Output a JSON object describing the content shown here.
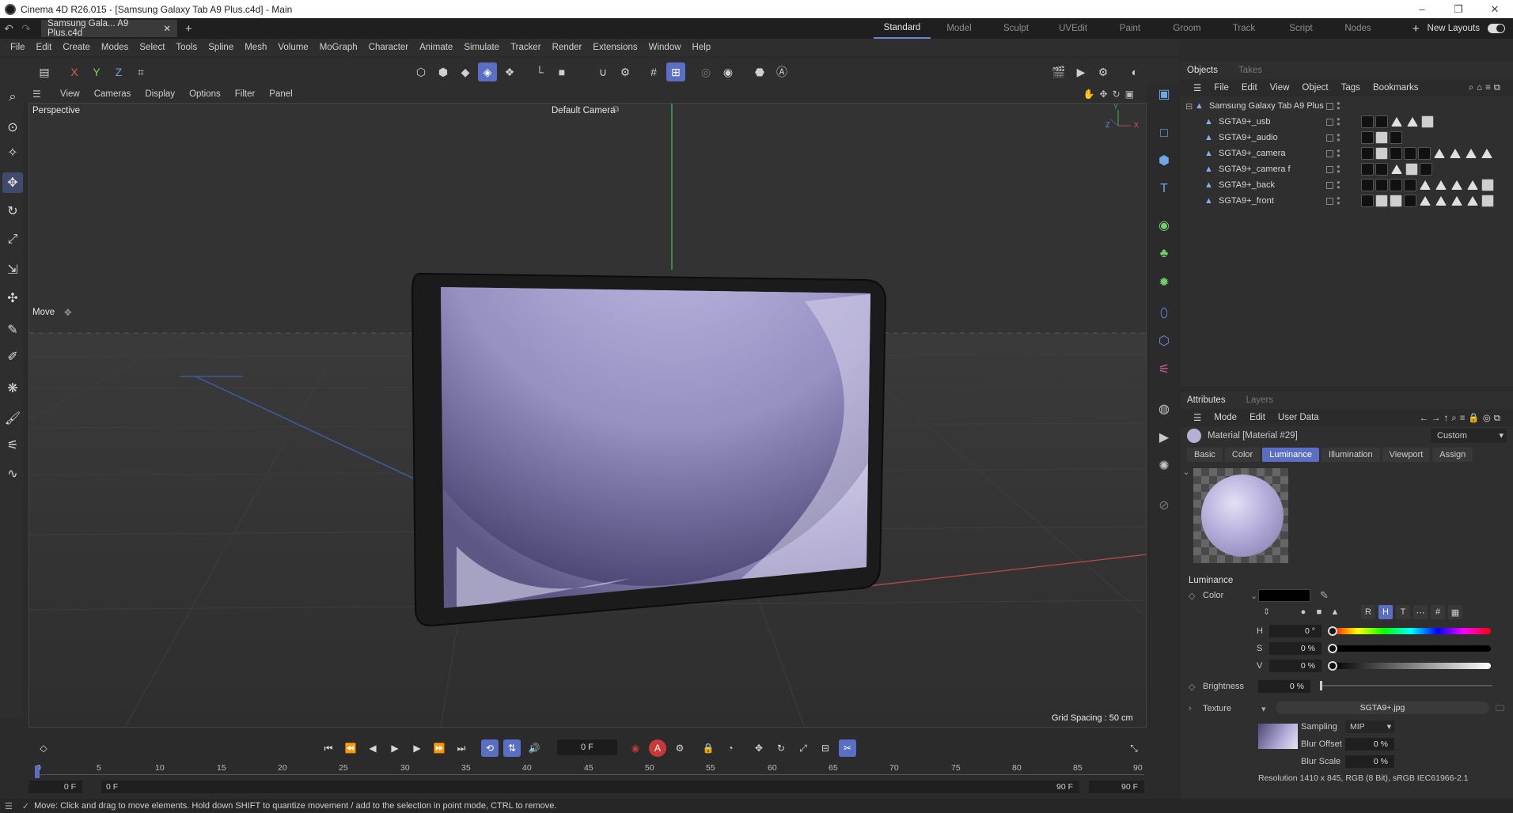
{
  "window": {
    "title": "Cinema 4D R26.015 - [Samsung Galaxy Tab A9 Plus.c4d] - Main",
    "controls": [
      "–",
      "❐",
      "✕"
    ]
  },
  "tabs": {
    "doc_tab": "Samsung Gala... A9 Plus.c4d",
    "layouts": [
      "Standard",
      "Model",
      "Sculpt",
      "UVEdit",
      "Paint",
      "Groom",
      "Track",
      "Script",
      "Nodes"
    ],
    "active_layout": "Standard",
    "new_layouts": "New Layouts"
  },
  "menu": [
    "File",
    "Edit",
    "Create",
    "Modes",
    "Select",
    "Tools",
    "Spline",
    "Mesh",
    "Volume",
    "MoGraph",
    "Character",
    "Animate",
    "Simulate",
    "Tracker",
    "Render",
    "Extensions",
    "Window",
    "Help"
  ],
  "toolbar": {
    "axis_x": "X",
    "axis_y": "Y",
    "axis_z": "Z"
  },
  "viewport": {
    "menu": [
      "View",
      "Cameras",
      "Display",
      "Options",
      "Filter",
      "Panel"
    ],
    "perspective_label": "Perspective",
    "camera_label": "Default Camera",
    "tool_label": "Move",
    "grid_spacing": "Grid Spacing : 50 cm",
    "axis_labels": {
      "y": "Y",
      "z": "Z",
      "x": "X"
    }
  },
  "timeline": {
    "current_frame": "0 F",
    "ruler": [
      "0",
      "5",
      "10",
      "15",
      "20",
      "25",
      "30",
      "35",
      "40",
      "45",
      "50",
      "55",
      "60",
      "65",
      "70",
      "75",
      "80",
      "85",
      "90"
    ],
    "start_a": "0 F",
    "start_b": "0 F",
    "end_a": "90 F",
    "end_b": "90 F",
    "record_label": "A"
  },
  "status": "Move: Click and drag to move elements. Hold down SHIFT to quantize movement / add to the selection in point mode, CTRL to remove.",
  "objects_panel": {
    "tabs": [
      "Objects",
      "Takes"
    ],
    "menu": [
      "File",
      "Edit",
      "View",
      "Object",
      "Tags",
      "Bookmarks"
    ],
    "root": "Samsung Galaxy Tab A9 Plus",
    "children": [
      "SGTA9+_usb",
      "SGTA9+_audio",
      "SGTA9+_camera",
      "SGTA9+_camera f",
      "SGTA9+_back",
      "SGTA9+_front"
    ]
  },
  "attributes": {
    "tabs": [
      "Attributes",
      "Layers"
    ],
    "menu": [
      "Mode",
      "Edit",
      "User Data"
    ],
    "material": "Material [Material #29]",
    "preset": "Custom",
    "mat_tabs": [
      "Basic",
      "Color",
      "Luminance",
      "Illumination",
      "Viewport",
      "Assign"
    ],
    "active_mat_tab": "Luminance",
    "section": "Luminance",
    "color_label": "Color",
    "channel_buttons": [
      "R",
      "H",
      "T"
    ],
    "h_label": "H",
    "h_value": "0 °",
    "s_label": "S",
    "s_value": "0 %",
    "v_label": "V",
    "v_value": "0 %",
    "brightness_label": "Brightness",
    "brightness_value": "0 %",
    "texture_label": "Texture",
    "texture_value": "SGTA9+.jpg",
    "sampling_label": "Sampling",
    "sampling_value": "MIP",
    "blur_offset_label": "Blur Offset",
    "blur_offset_value": "0 %",
    "blur_scale_label": "Blur Scale",
    "blur_scale_value": "0 %",
    "resolution": "Resolution 1410 x 845, RGB (8 Bit), sRGB IEC61966-2.1"
  },
  "colors": {
    "accent": "#5a6fc4",
    "screen_purple": "#a8a2d2"
  }
}
